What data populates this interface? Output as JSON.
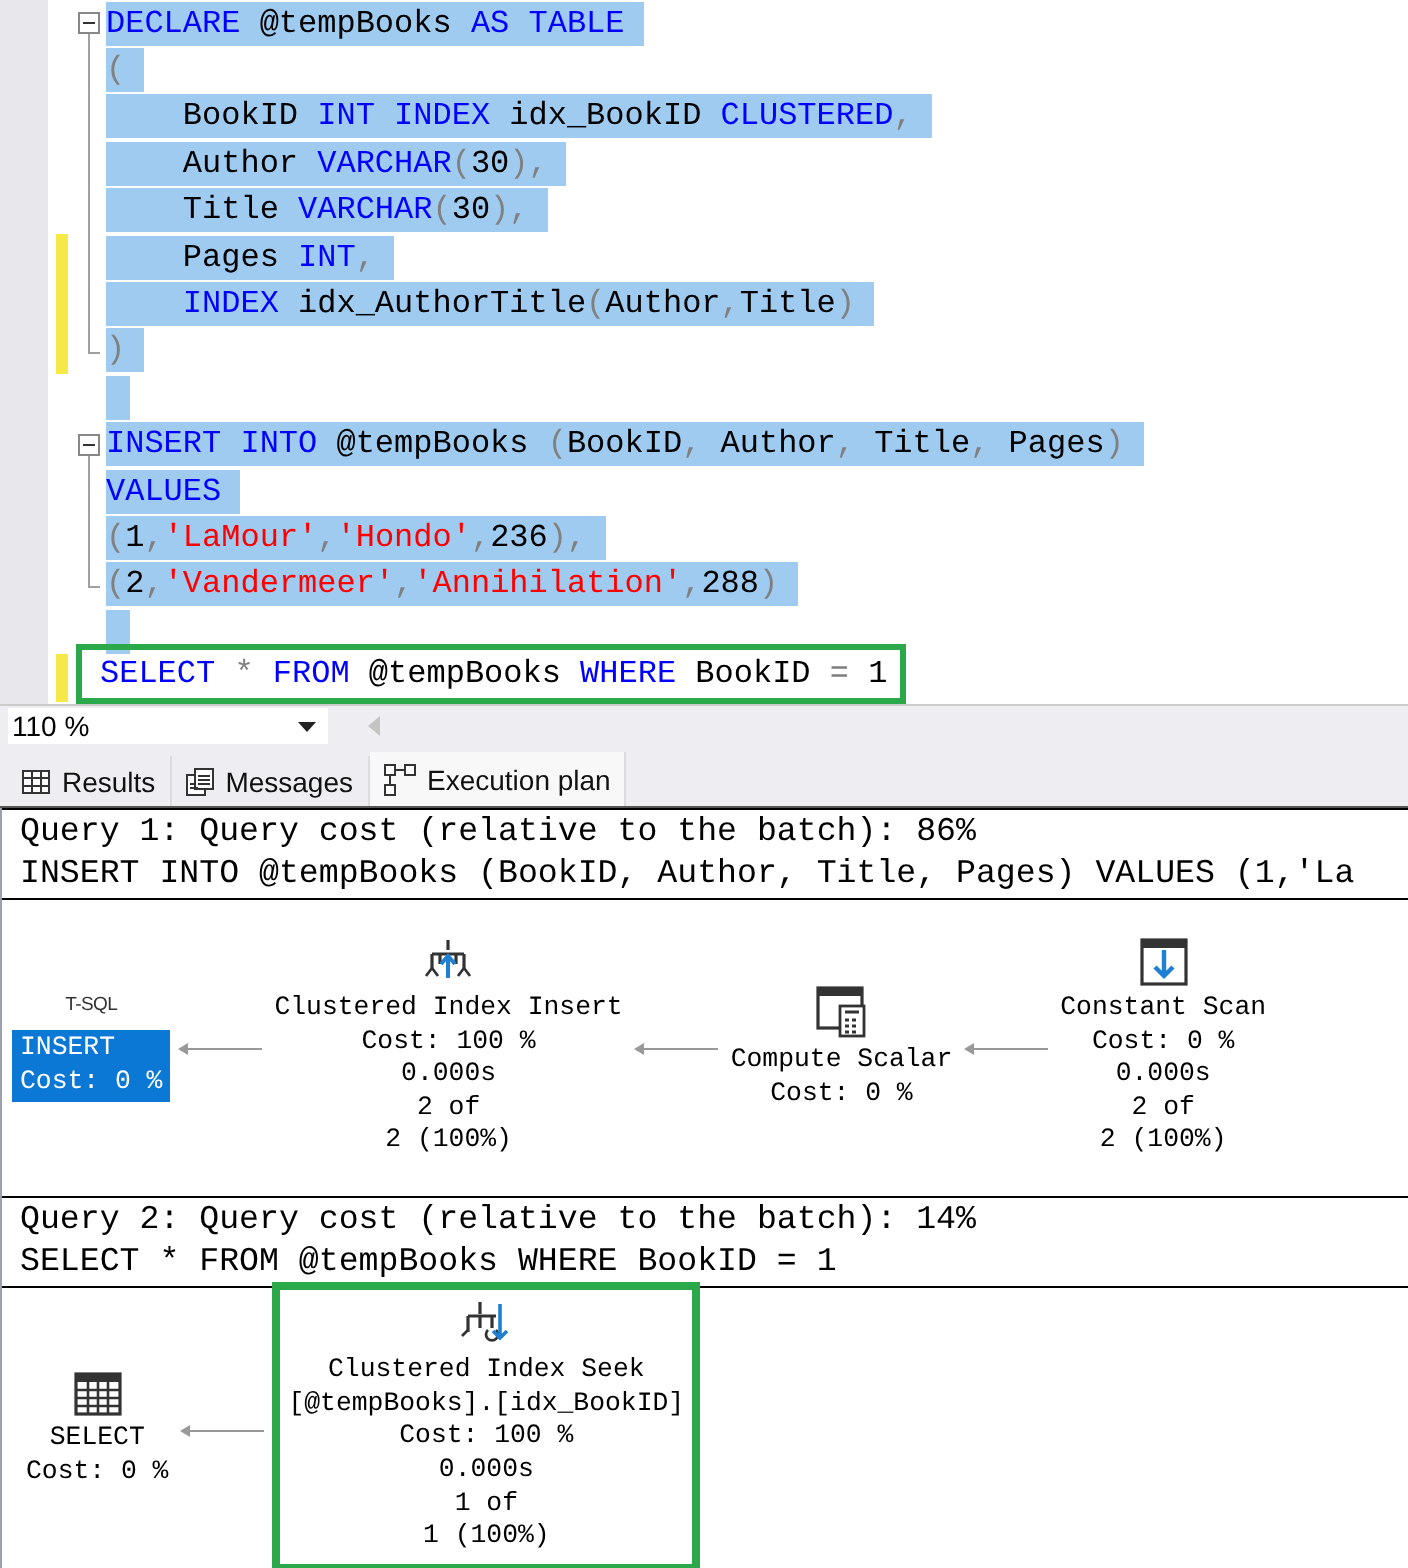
{
  "editor": {
    "lines": [
      {
        "kind": "block-start",
        "tokens": [
          {
            "kind": "keyword",
            "text": "DECLARE"
          },
          {
            "kind": "plain",
            "text": " @tempBooks "
          },
          {
            "kind": "keyword",
            "text": "AS "
          },
          {
            "kind": "keyword",
            "text": "TABLE"
          }
        ],
        "selected": true,
        "changed": false,
        "boxed": false
      },
      {
        "kind": "block-line",
        "tokens": [
          {
            "kind": "punct",
            "text": "("
          }
        ],
        "selected": true,
        "changed": false,
        "boxed": false
      },
      {
        "kind": "block-line",
        "tokens": [
          {
            "kind": "plain",
            "text": "    BookID "
          },
          {
            "kind": "keyword",
            "text": "INT "
          },
          {
            "kind": "keyword",
            "text": "INDEX"
          },
          {
            "kind": "plain",
            "text": " idx_BookID "
          },
          {
            "kind": "keyword",
            "text": "CLUSTERED"
          },
          {
            "kind": "punct",
            "text": ","
          }
        ],
        "selected": true,
        "changed": false,
        "boxed": false
      },
      {
        "kind": "block-line",
        "tokens": [
          {
            "kind": "plain",
            "text": "    Author "
          },
          {
            "kind": "keyword",
            "text": "VARCHAR"
          },
          {
            "kind": "punct",
            "text": "("
          },
          {
            "kind": "plain",
            "text": "30"
          },
          {
            "kind": "punct",
            "text": "),"
          }
        ],
        "selected": true,
        "changed": false,
        "boxed": false
      },
      {
        "kind": "block-line",
        "tokens": [
          {
            "kind": "plain",
            "text": "    Title "
          },
          {
            "kind": "keyword",
            "text": "VARCHAR"
          },
          {
            "kind": "punct",
            "text": "("
          },
          {
            "kind": "plain",
            "text": "30"
          },
          {
            "kind": "punct",
            "text": "),"
          }
        ],
        "selected": true,
        "changed": false,
        "boxed": false
      },
      {
        "kind": "block-line",
        "tokens": [
          {
            "kind": "plain",
            "text": "    Pages "
          },
          {
            "kind": "keyword",
            "text": "INT"
          },
          {
            "kind": "punct",
            "text": ","
          }
        ],
        "selected": true,
        "changed": true,
        "boxed": false
      },
      {
        "kind": "block-line",
        "tokens": [
          {
            "kind": "keyword",
            "text": "    INDEX"
          },
          {
            "kind": "plain",
            "text": " idx_AuthorTitle"
          },
          {
            "kind": "punct",
            "text": "("
          },
          {
            "kind": "plain",
            "text": "Author"
          },
          {
            "kind": "punct",
            "text": ","
          },
          {
            "kind": "plain",
            "text": "Title"
          },
          {
            "kind": "punct",
            "text": ")"
          }
        ],
        "selected": true,
        "changed": true,
        "boxed": false
      },
      {
        "kind": "block-end",
        "tokens": [
          {
            "kind": "punct",
            "text": ")"
          }
        ],
        "selected": true,
        "changed": true,
        "boxed": false
      },
      {
        "kind": "line",
        "selected": true,
        "changed": false,
        "boxed": false
      },
      {
        "kind": "block-start",
        "tokens": [
          {
            "kind": "keyword",
            "text": "INSERT "
          },
          {
            "kind": "keyword",
            "text": "INTO"
          },
          {
            "kind": "plain",
            "text": " @tempBooks "
          },
          {
            "kind": "punct",
            "text": "("
          },
          {
            "kind": "plain",
            "text": "BookID"
          },
          {
            "kind": "punct",
            "text": ", "
          },
          {
            "kind": "plain",
            "text": "Author"
          },
          {
            "kind": "punct",
            "text": ", "
          },
          {
            "kind": "plain",
            "text": "Title"
          },
          {
            "kind": "punct",
            "text": ", "
          },
          {
            "kind": "plain",
            "text": "Pages"
          },
          {
            "kind": "punct",
            "text": ")"
          }
        ],
        "selected": true,
        "changed": false,
        "boxed": false
      },
      {
        "kind": "block-line",
        "tokens": [
          {
            "kind": "keyword",
            "text": "VALUES"
          }
        ],
        "selected": true,
        "changed": false,
        "boxed": false
      },
      {
        "kind": "block-line",
        "tokens": [
          {
            "kind": "punct",
            "text": "("
          },
          {
            "kind": "plain",
            "text": "1"
          },
          {
            "kind": "punct",
            "text": ","
          },
          {
            "kind": "string",
            "text": "'LaMour'"
          },
          {
            "kind": "punct",
            "text": ","
          },
          {
            "kind": "string",
            "text": "'Hondo'"
          },
          {
            "kind": "punct",
            "text": ","
          },
          {
            "kind": "plain",
            "text": "236"
          },
          {
            "kind": "punct",
            "text": "),"
          }
        ],
        "selected": true,
        "changed": false,
        "boxed": false
      },
      {
        "kind": "block-end",
        "tokens": [
          {
            "kind": "punct",
            "text": "("
          },
          {
            "kind": "plain",
            "text": "2"
          },
          {
            "kind": "punct",
            "text": ","
          },
          {
            "kind": "string",
            "text": "'Vandermeer'"
          },
          {
            "kind": "punct",
            "text": ","
          },
          {
            "kind": "string",
            "text": "'Annihilation'"
          },
          {
            "kind": "punct",
            "text": ","
          },
          {
            "kind": "plain",
            "text": "288"
          },
          {
            "kind": "punct",
            "text": ")"
          }
        ],
        "selected": true,
        "changed": false,
        "boxed": false
      },
      {
        "kind": "line",
        "selected": true,
        "changed": false,
        "boxed": false
      },
      {
        "kind": "line",
        "tokens": [
          {
            "kind": "keyword",
            "text": "SELECT"
          },
          {
            "kind": "punct",
            "text": " * "
          },
          {
            "kind": "keyword",
            "text": "FROM"
          },
          {
            "kind": "plain",
            "text": " @tempBooks "
          },
          {
            "kind": "keyword",
            "text": "WHERE"
          },
          {
            "kind": "plain",
            "text": " BookID "
          },
          {
            "kind": "punct",
            "text": "="
          },
          {
            "kind": "plain",
            "text": " 1"
          }
        ],
        "selected": false,
        "changed": true,
        "boxed": true
      }
    ]
  },
  "zoom": {
    "value": "110 %"
  },
  "result_tabs": [
    {
      "label": "Results",
      "selected": false
    },
    {
      "label": "Messages",
      "selected": false
    },
    {
      "label": "Execution plan",
      "selected": true
    }
  ],
  "queries": [
    {
      "header": "Query 1: Query cost (relative to the batch): 86%",
      "statement": "INSERT INTO @tempBooks (BookID, Author, Title, Pages) VALUES (1,'La",
      "nodes": [
        {
          "kind": "statement",
          "caption": "T-SQL",
          "lines": [
            "INSERT",
            "Cost: 0 %"
          ],
          "selected": true,
          "boxed": false
        },
        {
          "kind": "index-insert",
          "lines": [
            "Clustered Index Insert",
            "Cost: 100 %",
            "0.000s",
            "2 of",
            "2 (100%)"
          ],
          "selected": false,
          "boxed": false
        },
        {
          "kind": "compute-scalar",
          "lines": [
            "Compute Scalar",
            "Cost: 0 %"
          ],
          "selected": false,
          "boxed": false
        },
        {
          "kind": "constant-scan",
          "lines": [
            "Constant Scan",
            "Cost: 0 %",
            "0.000s",
            "2 of",
            "2 (100%)"
          ],
          "selected": false,
          "boxed": false
        }
      ]
    },
    {
      "header": "Query 2: Query cost (relative to the batch): 14%",
      "statement": "SELECT * FROM @tempBooks WHERE BookID = 1",
      "nodes": [
        {
          "kind": "select",
          "lines": [
            "SELECT",
            "Cost: 0 %"
          ],
          "selected": false,
          "boxed": false
        },
        {
          "kind": "index-seek",
          "lines": [
            "Clustered Index Seek",
            "[@tempBooks].[idx_BookID]",
            "Cost: 100 %",
            "0.000s",
            "1 of",
            "1 (100%)"
          ],
          "selected": false,
          "boxed": true
        }
      ]
    }
  ]
}
